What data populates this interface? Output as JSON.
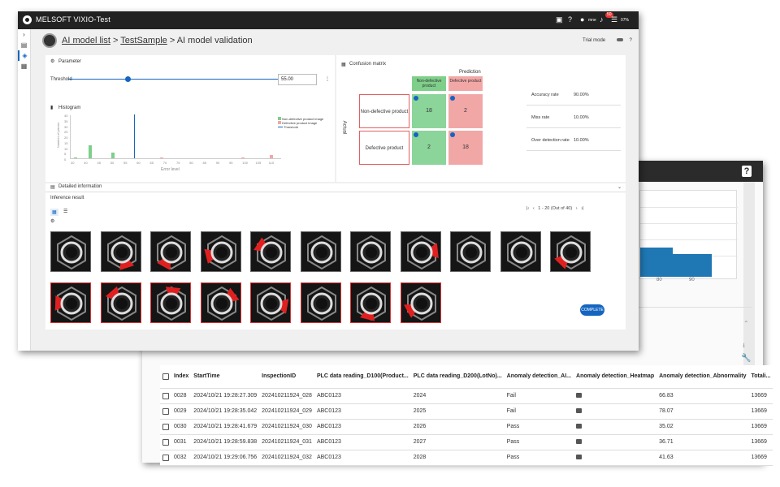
{
  "app": {
    "title": "MELSOFT VIXIO-Test",
    "user": "mne",
    "notif_count": "50",
    "battery": "07%"
  },
  "breadcrumb": {
    "home": "AI model list",
    "project": "TestSample",
    "page": "AI model validation",
    "sep": ">"
  },
  "trial": {
    "label": "Trial mode"
  },
  "parameter": {
    "title": "Parameter",
    "threshold_label": "Threshold",
    "threshold_value": "55.00",
    "threshold_fraction": 0.27
  },
  "histogram": {
    "title": "Histogram",
    "ylabel": "Number of pieces",
    "xlabel": "Error level",
    "legend": [
      "Non-defective product image",
      "Defective product image",
      "Threshold"
    ],
    "colors": {
      "good": "#7ecf8a",
      "bad": "#f2a7a7",
      "threshold": "#1565c0"
    },
    "x_ticks": [
      "30",
      "40",
      "45",
      "50",
      "55",
      "60",
      "65",
      "70",
      "75",
      "80",
      "85",
      "90",
      "95",
      "100",
      "105",
      "110"
    ],
    "y_ticks": [
      "0",
      "5",
      "10",
      "15",
      "20",
      "25",
      "30",
      "35",
      "40"
    ]
  },
  "detail": {
    "title": "Detailed information"
  },
  "confusion": {
    "title": "Confusion matrix",
    "prediction": "Prediction",
    "actual": "Actual",
    "col_labels": [
      "Non-defective product",
      "Defective product"
    ],
    "row_labels": [
      "Non-defective product",
      "Defective product"
    ],
    "cells": [
      [
        "18",
        "2"
      ],
      [
        "2",
        "18"
      ]
    ]
  },
  "metrics": [
    {
      "label": "Accuracy rate",
      "value": "90.00%"
    },
    {
      "label": "Miss rate",
      "value": "10.00%"
    },
    {
      "label": "Over detection rate",
      "value": "10.00%"
    }
  ],
  "inference": {
    "title": "Inference result",
    "pager": "1 - 20 (Out of 40)",
    "complete": "COMPLETE",
    "tiles": [
      "ok",
      "ng",
      "ng",
      "ng",
      "ng",
      "ok",
      "ok",
      "ng",
      "ok",
      "ok",
      "ng",
      "ng",
      "ng",
      "ng",
      "ng",
      "ng",
      "ok",
      "ng",
      "ng"
    ]
  },
  "back_table": {
    "columns": [
      "Index",
      "StartTime",
      "InspectionID",
      "PLC data reading_D100(Product...",
      "PLC data reading_D200(LotNo)...",
      "Anomaly detection_AI...",
      "Anomaly detection_Heatmap",
      "Anomaly detection_Abnormality",
      "Totali..."
    ],
    "rows": [
      [
        "0028",
        "2024/10/21 19:28:27.309",
        "2024102119​24_028",
        "ABC0123",
        "2024",
        "Fail",
        "",
        "66.83",
        "13669"
      ],
      [
        "0029",
        "2024/10/21 19:28:35.042",
        "202410211924_029",
        "ABC0123",
        "2025",
        "Fail",
        "",
        "78.07",
        "13669"
      ],
      [
        "0030",
        "2024/10/21 19:28:41.679",
        "202410211924_030",
        "ABC0123",
        "2026",
        "Pass",
        "",
        "35.02",
        "13669"
      ],
      [
        "0031",
        "2024/10/21 19:28:59.838",
        "202410211924_031",
        "ABC0123",
        "2027",
        "Pass",
        "",
        "36.71",
        "13669"
      ],
      [
        "0032",
        "2024/10/21 19:29:06.756",
        "202410211924_032",
        "ABC0123",
        "2028",
        "Pass",
        "",
        "41.63",
        "13669"
      ]
    ]
  },
  "back_chart": {
    "ticks": [
      "80",
      "90"
    ]
  }
}
